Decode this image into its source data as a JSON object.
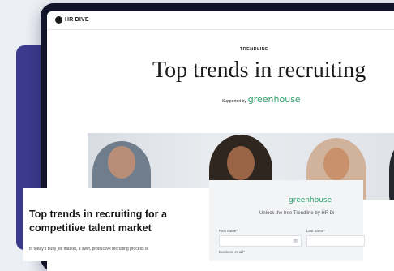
{
  "app": {
    "brand": "HR DIVE"
  },
  "hero": {
    "eyebrow": "TRENDLINE",
    "title": "Top trends in recruiting",
    "supported_label": "Supported by",
    "supported_brand": "greenhouse"
  },
  "article": {
    "title": "Top trends in recruiting for a competitive talent market",
    "intro": "In today's busy job market, a swift, productive recruiting process is"
  },
  "form": {
    "brand": "greenhouse",
    "subtitle": "Unlock the free Trendline by HR Di",
    "first_name_label": "First name*",
    "last_name_label": "Last name*",
    "business_email_label": "Business email*"
  },
  "colors": {
    "brand_green": "#2fa06b",
    "device_frame": "#12142a",
    "backdrop_slab": "#3b3a8c"
  }
}
